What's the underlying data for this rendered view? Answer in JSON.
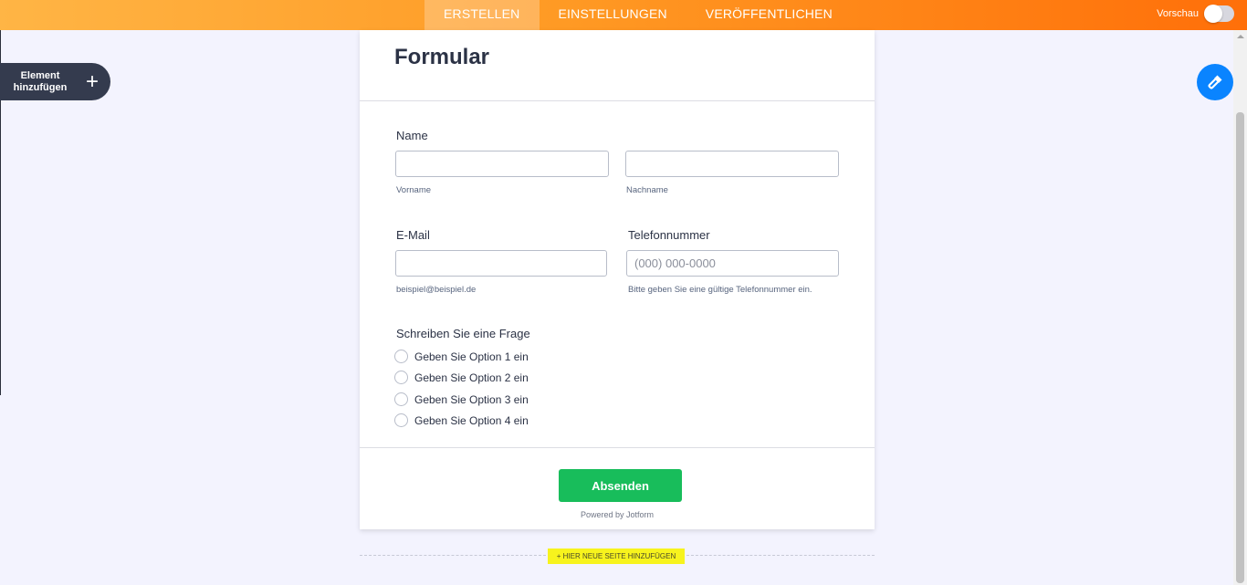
{
  "topbar": {
    "tabs": [
      {
        "label": "ERSTELLEN",
        "active": true
      },
      {
        "label": "EINSTELLUNGEN",
        "active": false
      },
      {
        "label": "VERÖFFENTLICHEN",
        "active": false
      }
    ],
    "preview_label": "Vorschau",
    "preview_enabled": false
  },
  "sidebar": {
    "add_element_label": "Element hinzufügen",
    "add_icon": "plus-icon"
  },
  "paint_button": {
    "icon": "paint-roller-icon",
    "color": "#0a84ff"
  },
  "form": {
    "title": "Formular",
    "name": {
      "label": "Name",
      "first_value": "",
      "first_sublabel": "Vorname",
      "last_value": "",
      "last_sublabel": "Nachname"
    },
    "email": {
      "label": "E-Mail",
      "value": "",
      "sublabel": "beispiel@beispiel.de"
    },
    "phone": {
      "label": "Telefonnummer",
      "placeholder": "(000) 000-0000",
      "sublabel": "Bitte geben Sie eine gültige Telefonnummer ein."
    },
    "question": {
      "label": "Schreiben Sie eine Frage",
      "options": [
        "Geben Sie Option 1 ein",
        "Geben Sie Option 2 ein",
        "Geben Sie Option 3 ein",
        "Geben Sie Option 4 ein"
      ]
    },
    "submit_label": "Absenden",
    "powered_by": "Powered by Jotform"
  },
  "add_page_label": "+ HIER NEUE SEITE HINZUFÜGEN",
  "colors": {
    "accent_orange": "#ff7a0e",
    "submit_green": "#18bd5b",
    "add_page_yellow": "#f7f31d"
  }
}
